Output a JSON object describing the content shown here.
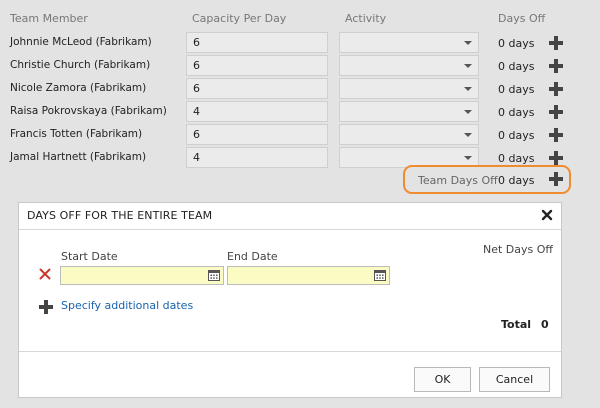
{
  "table": {
    "headers": {
      "member": "Team Member",
      "capacity": "Capacity Per Day",
      "activity": "Activity",
      "days_off": "Days Off"
    },
    "rows": [
      {
        "member": "Johnnie McLeod (Fabrikam)",
        "capacity": "6",
        "activity": "",
        "days_off": "0 days"
      },
      {
        "member": "Christie Church (Fabrikam)",
        "capacity": "6",
        "activity": "",
        "days_off": "0 days"
      },
      {
        "member": "Nicole Zamora (Fabrikam)",
        "capacity": "6",
        "activity": "",
        "days_off": "0 days"
      },
      {
        "member": "Raisa Pokrovskaya (Fabrikam)",
        "capacity": "4",
        "activity": "",
        "days_off": "0 days"
      },
      {
        "member": "Francis Totten (Fabrikam)",
        "capacity": "6",
        "activity": "",
        "days_off": "0 days"
      },
      {
        "member": "Jamal Hartnett (Fabrikam)",
        "capacity": "4",
        "activity": "",
        "days_off": "0 days"
      }
    ]
  },
  "team_days_off": {
    "label": "Team Days Off",
    "value": "0 days"
  },
  "dialog": {
    "title": "DAYS OFF FOR THE ENTIRE TEAM",
    "start_date_label": "Start Date",
    "end_date_label": "End Date",
    "net_days_off_label": "Net Days Off",
    "start_date_value": "",
    "end_date_value": "",
    "specify_link": "Specify additional dates",
    "total_label": "Total",
    "total_value": "0",
    "ok_label": "OK",
    "cancel_label": "Cancel"
  },
  "colors": {
    "highlight": "#ef8c2f",
    "link": "#1864b0",
    "remove_icon": "#c8392b",
    "date_field": "#fbfbc4"
  },
  "icons": [
    "plus-icon",
    "close-icon",
    "remove-icon",
    "calendar-icon",
    "chevron-down-icon"
  ]
}
